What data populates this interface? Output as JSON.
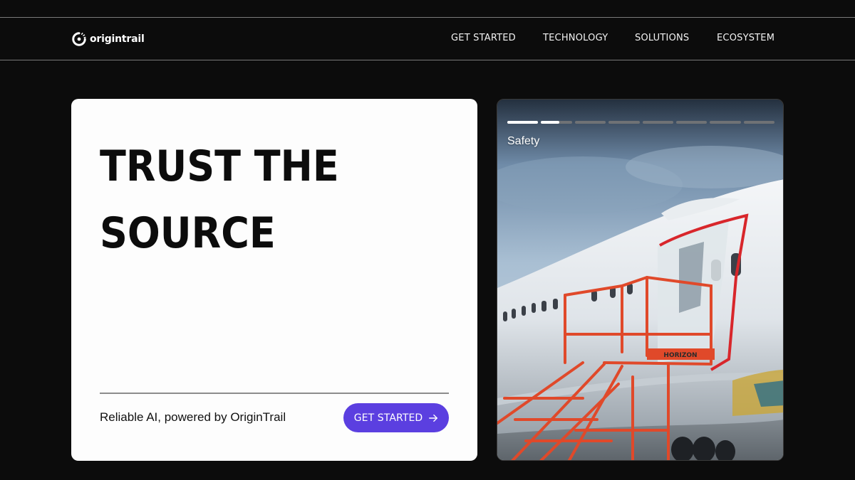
{
  "brand": {
    "name": "origintrail",
    "logo_icon": "origintrail-logo-icon"
  },
  "nav": {
    "items": [
      {
        "label": "GET STARTED"
      },
      {
        "label": "TECHNOLOGY"
      },
      {
        "label": "SOLUTIONS"
      },
      {
        "label": "ECOSYSTEM"
      }
    ]
  },
  "hero": {
    "title_line1": "TRUST THE",
    "title_line2": "SOURCE",
    "tagline": "Reliable AI, powered by OriginTrail",
    "cta_label": "GET STARTED",
    "cta_icon": "arrow-right-icon",
    "cta_color": "#5b3fe0"
  },
  "story": {
    "label": "Safety",
    "segments": [
      {
        "progress": 1.0
      },
      {
        "progress": 0.6
      },
      {
        "progress": 0
      },
      {
        "progress": 0
      },
      {
        "progress": 0
      },
      {
        "progress": 0
      },
      {
        "progress": 0
      },
      {
        "progress": 0
      }
    ],
    "image_text": "HORIZON"
  },
  "colors": {
    "background": "#0c0c0c",
    "card": "#fdfdfd",
    "accent": "#5b3fe0"
  }
}
